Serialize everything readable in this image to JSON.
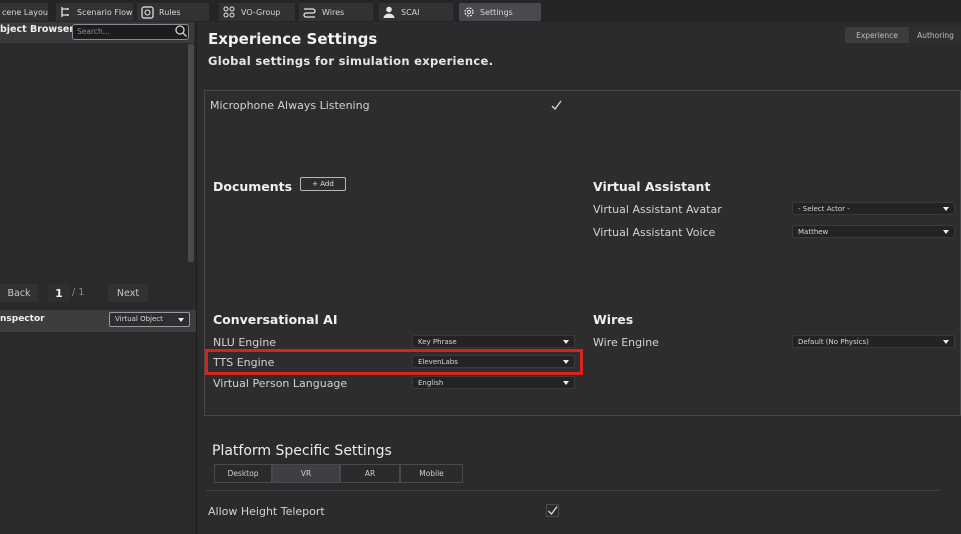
{
  "tabs": [
    {
      "label": "cene Layout",
      "icon": ""
    },
    {
      "label": "Scenario Flow",
      "icon": "flow-icon"
    },
    {
      "label": "Rules",
      "icon": "rules-icon"
    },
    {
      "label": "VO-Group",
      "icon": "vo-group-icon"
    },
    {
      "label": "Wires",
      "icon": "wires-icon"
    },
    {
      "label": "SCAI",
      "icon": "person-icon"
    },
    {
      "label": "Settings",
      "icon": "gear-icon"
    }
  ],
  "object_browser": {
    "title": "bject Browser",
    "search_placeholder": "Search..."
  },
  "pager": {
    "back": "Back",
    "current": "1",
    "total": "/ 1",
    "next": "Next"
  },
  "inspector": {
    "title": "nspector",
    "select_value": "Virtual Object"
  },
  "header": {
    "title": "Experience Settings",
    "subtitle": "Global settings for simulation experience.",
    "mode_experience": "Experience",
    "mode_authoring": "Authoring"
  },
  "settings": {
    "microphone_label": "Microphone Always Listening",
    "microphone_checked": true,
    "documents_title": "Documents",
    "add_label": "+ Add",
    "virtual_assistant_title": "Virtual Assistant",
    "va_avatar_label": "Virtual Assistant Avatar",
    "va_avatar_value": "- Select Actor -",
    "va_voice_label": "Virtual Assistant Voice",
    "va_voice_value": "Matthew",
    "conversational_ai_title": "Conversational AI",
    "nlu_label": "NLU Engine",
    "nlu_value": "Key Phrase",
    "tts_label": "TTS Engine",
    "tts_value": "ElevenLabs",
    "language_label": "Virtual Person Language",
    "language_value": "English",
    "wires_title": "Wires",
    "wire_engine_label": "Wire Engine",
    "wire_engine_value": "Default (No Physics)"
  },
  "platform": {
    "title": "Platform Specific Settings",
    "tabs": [
      "Desktop",
      "VR",
      "AR",
      "Mobile"
    ],
    "active_tab": "VR",
    "teleport_label": "Allow Height Teleport",
    "teleport_checked": true
  },
  "colors": {
    "highlight": "#e01e1e",
    "background": "#2b2b2d"
  }
}
